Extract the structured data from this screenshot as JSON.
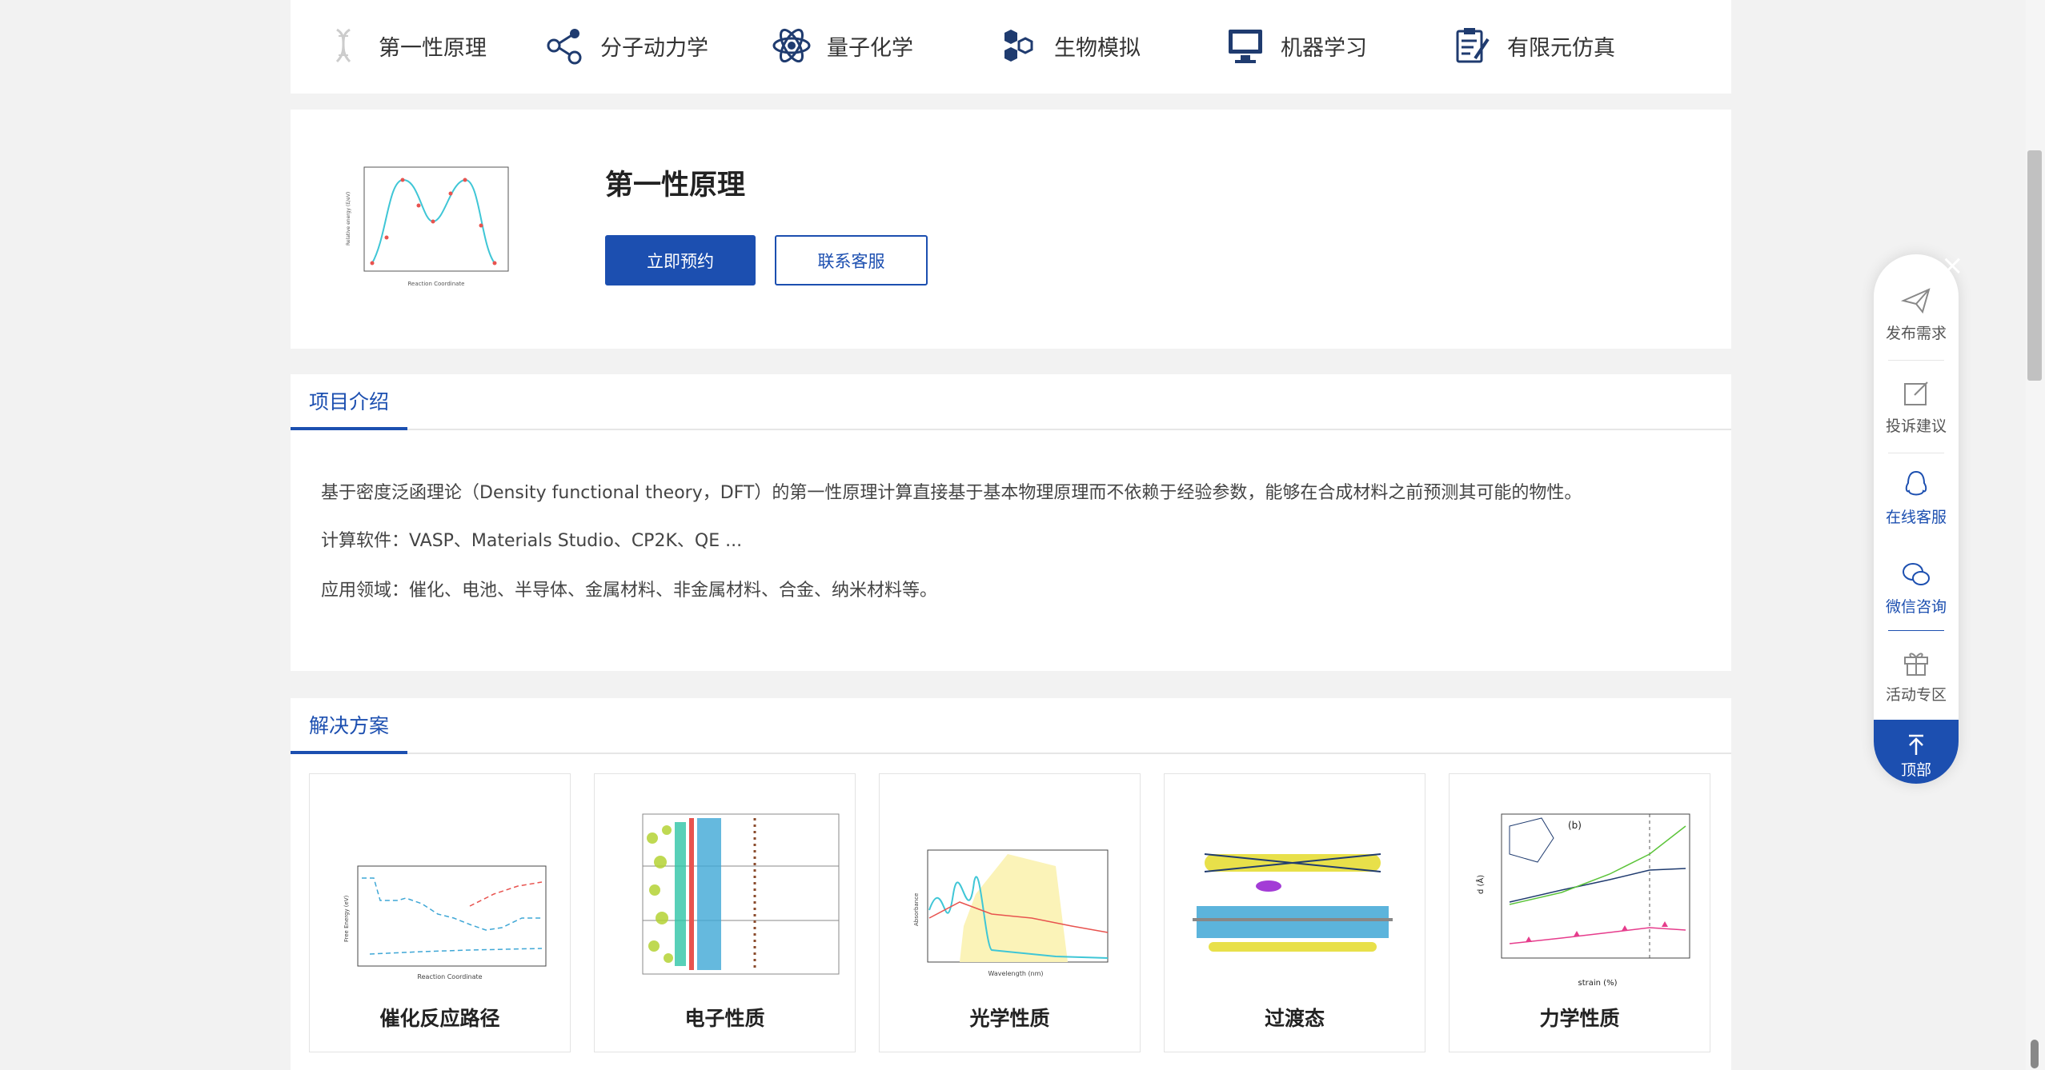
{
  "categories": [
    {
      "label": "第一性原理",
      "icon": "dna-icon"
    },
    {
      "label": "分子动力学",
      "icon": "molecule-icon"
    },
    {
      "label": "量子化学",
      "icon": "atom-icon"
    },
    {
      "label": "生物模拟",
      "icon": "hexagon-cluster-icon"
    },
    {
      "label": "机器学习",
      "icon": "monitor-icon"
    },
    {
      "label": "有限元仿真",
      "icon": "clipboard-pen-icon"
    }
  ],
  "hero": {
    "title": "第一性原理",
    "book_button": "立即预约",
    "contact_button": "联系客服",
    "thumbnail_xlabel": "Reaction Coordinate",
    "thumbnail_ylabel": "Relative energy (E/eV)"
  },
  "intro": {
    "tab": "项目介绍",
    "line1": "基于密度泛函理论（Density functional theory，DFT）的第一性原理计算直接基于基本物理原理而不依赖于经验参数，能够在合成材料之前预测其可能的物性。",
    "line2": "计算软件：VASP、Materials Studio、CP2K、QE ...",
    "line3": "应用领域：催化、电池、半导体、金属材料、非金属材料、合金、纳米材料等。"
  },
  "solutions": {
    "tab": "解决方案",
    "cards": [
      {
        "label": "催化反应路径",
        "xlabel": "Reaction Coordinate",
        "ylabel": "Free Energy (eV)"
      },
      {
        "label": "电子性质"
      },
      {
        "label": "光学性质",
        "xlabel": "Wavelength (nm)",
        "ylabel": "Absorbance"
      },
      {
        "label": "过渡态"
      },
      {
        "label": "力学性质",
        "xlabel": "strain (%)",
        "ylabel": "d (Å)",
        "panel_tag": "(b)"
      }
    ]
  },
  "float_bar": {
    "items": [
      {
        "label": "发布需求",
        "icon": "paper-plane-icon"
      },
      {
        "label": "投诉建议",
        "icon": "edit-icon"
      },
      {
        "label": "在线客服",
        "icon": "qq-icon"
      },
      {
        "label": "微信咨询",
        "icon": "wechat-icon"
      },
      {
        "label": "活动专区",
        "icon": "gift-icon"
      }
    ],
    "top_label": "顶部",
    "close_glyph": "×"
  },
  "colors": {
    "accent": "#1c4fb0",
    "cyan": "#3fc6d6",
    "red": "#e8534f"
  }
}
